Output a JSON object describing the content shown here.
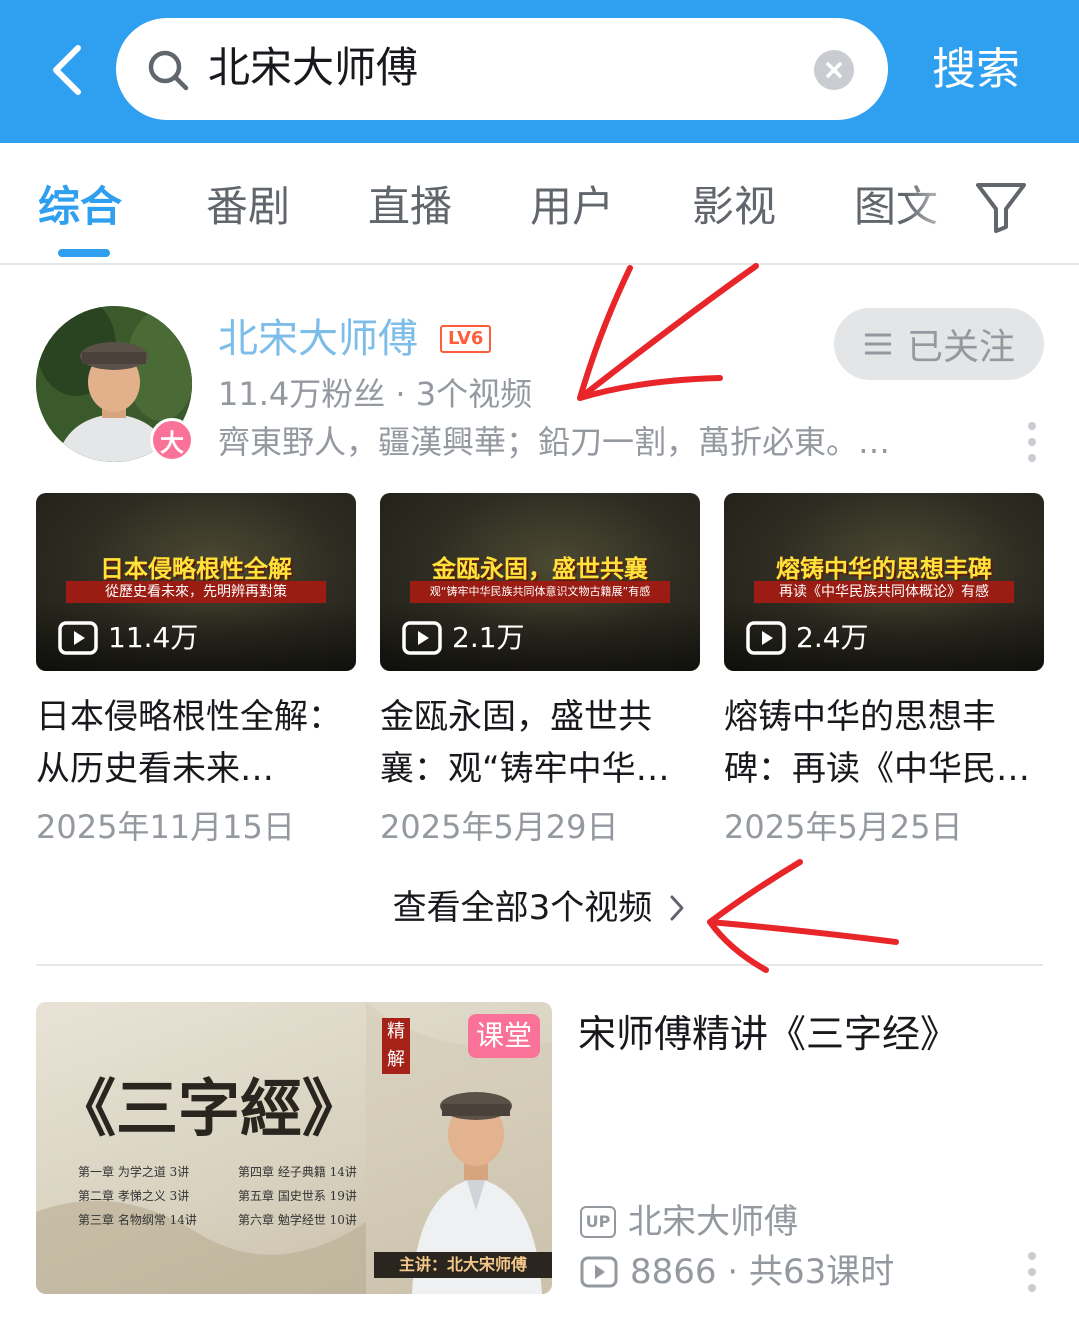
{
  "header": {
    "search_query": "北宋大师傅",
    "search_button": "搜索",
    "back_icon": "chevron-left-icon",
    "search_icon": "search-icon",
    "clear_icon": "close-icon"
  },
  "tabs": [
    {
      "label": "综合",
      "active": true
    },
    {
      "label": "番剧"
    },
    {
      "label": "直播"
    },
    {
      "label": "用户"
    },
    {
      "label": "影视"
    },
    {
      "label": "图文"
    }
  ],
  "user": {
    "name": "北宋大师傅",
    "level": "LV6",
    "avatar_badge": "大",
    "follow_label": "已关注",
    "fans_line": "11.4万粉丝 · 3个视频",
    "signature": "齊東野人，疆漢興華；鉛刀一割，萬折必東。…"
  },
  "videos": [
    {
      "thumb_title": "日本侵略根性全解",
      "thumb_sub": "從歷史看未來，先明辨再對策",
      "plays": "11.4万",
      "title": "日本侵略根性全解：从历史看未来…",
      "date": "2025年11月15日"
    },
    {
      "thumb_title": "金瓯永固，盛世共襄",
      "thumb_sub": "观“铸牢中华民族共同体意识文物古籍展”有感",
      "plays": "2.1万",
      "title": "金瓯永固，盛世共襄：观“铸牢中华…",
      "date": "2025年5月29日"
    },
    {
      "thumb_title": "熔铸中华的思想丰碑",
      "thumb_sub": "再读《中华民族共同体概论》有感",
      "plays": "2.4万",
      "title": "熔铸中华的思想丰碑：再读《中华民…",
      "date": "2025年5月25日"
    }
  ],
  "view_all": "查看全部3个视频",
  "course": {
    "thumb_title": "《三字經》",
    "thumb_seal": "精解",
    "tag": "课堂",
    "chapters": [
      "第一章 为学之道 3讲",
      "第四章 经子典籍 14讲",
      "第二章 孝悌之义 3讲",
      "第五章 国史世系 19讲",
      "第三章 名物纲常 14讲",
      "第六章 勉学经世 10讲"
    ],
    "lecturer": "主讲：北大宋师傅",
    "title": "宋师傅精讲《三字经》",
    "up_tag": "UP",
    "up_name": "北宋大师傅",
    "stats": "8866 · 共63课时"
  },
  "colors": {
    "accent": "#2f9ff0",
    "name_blue": "#7dbde9",
    "pink": "#fb7299",
    "annotation_red": "#e8262a"
  }
}
